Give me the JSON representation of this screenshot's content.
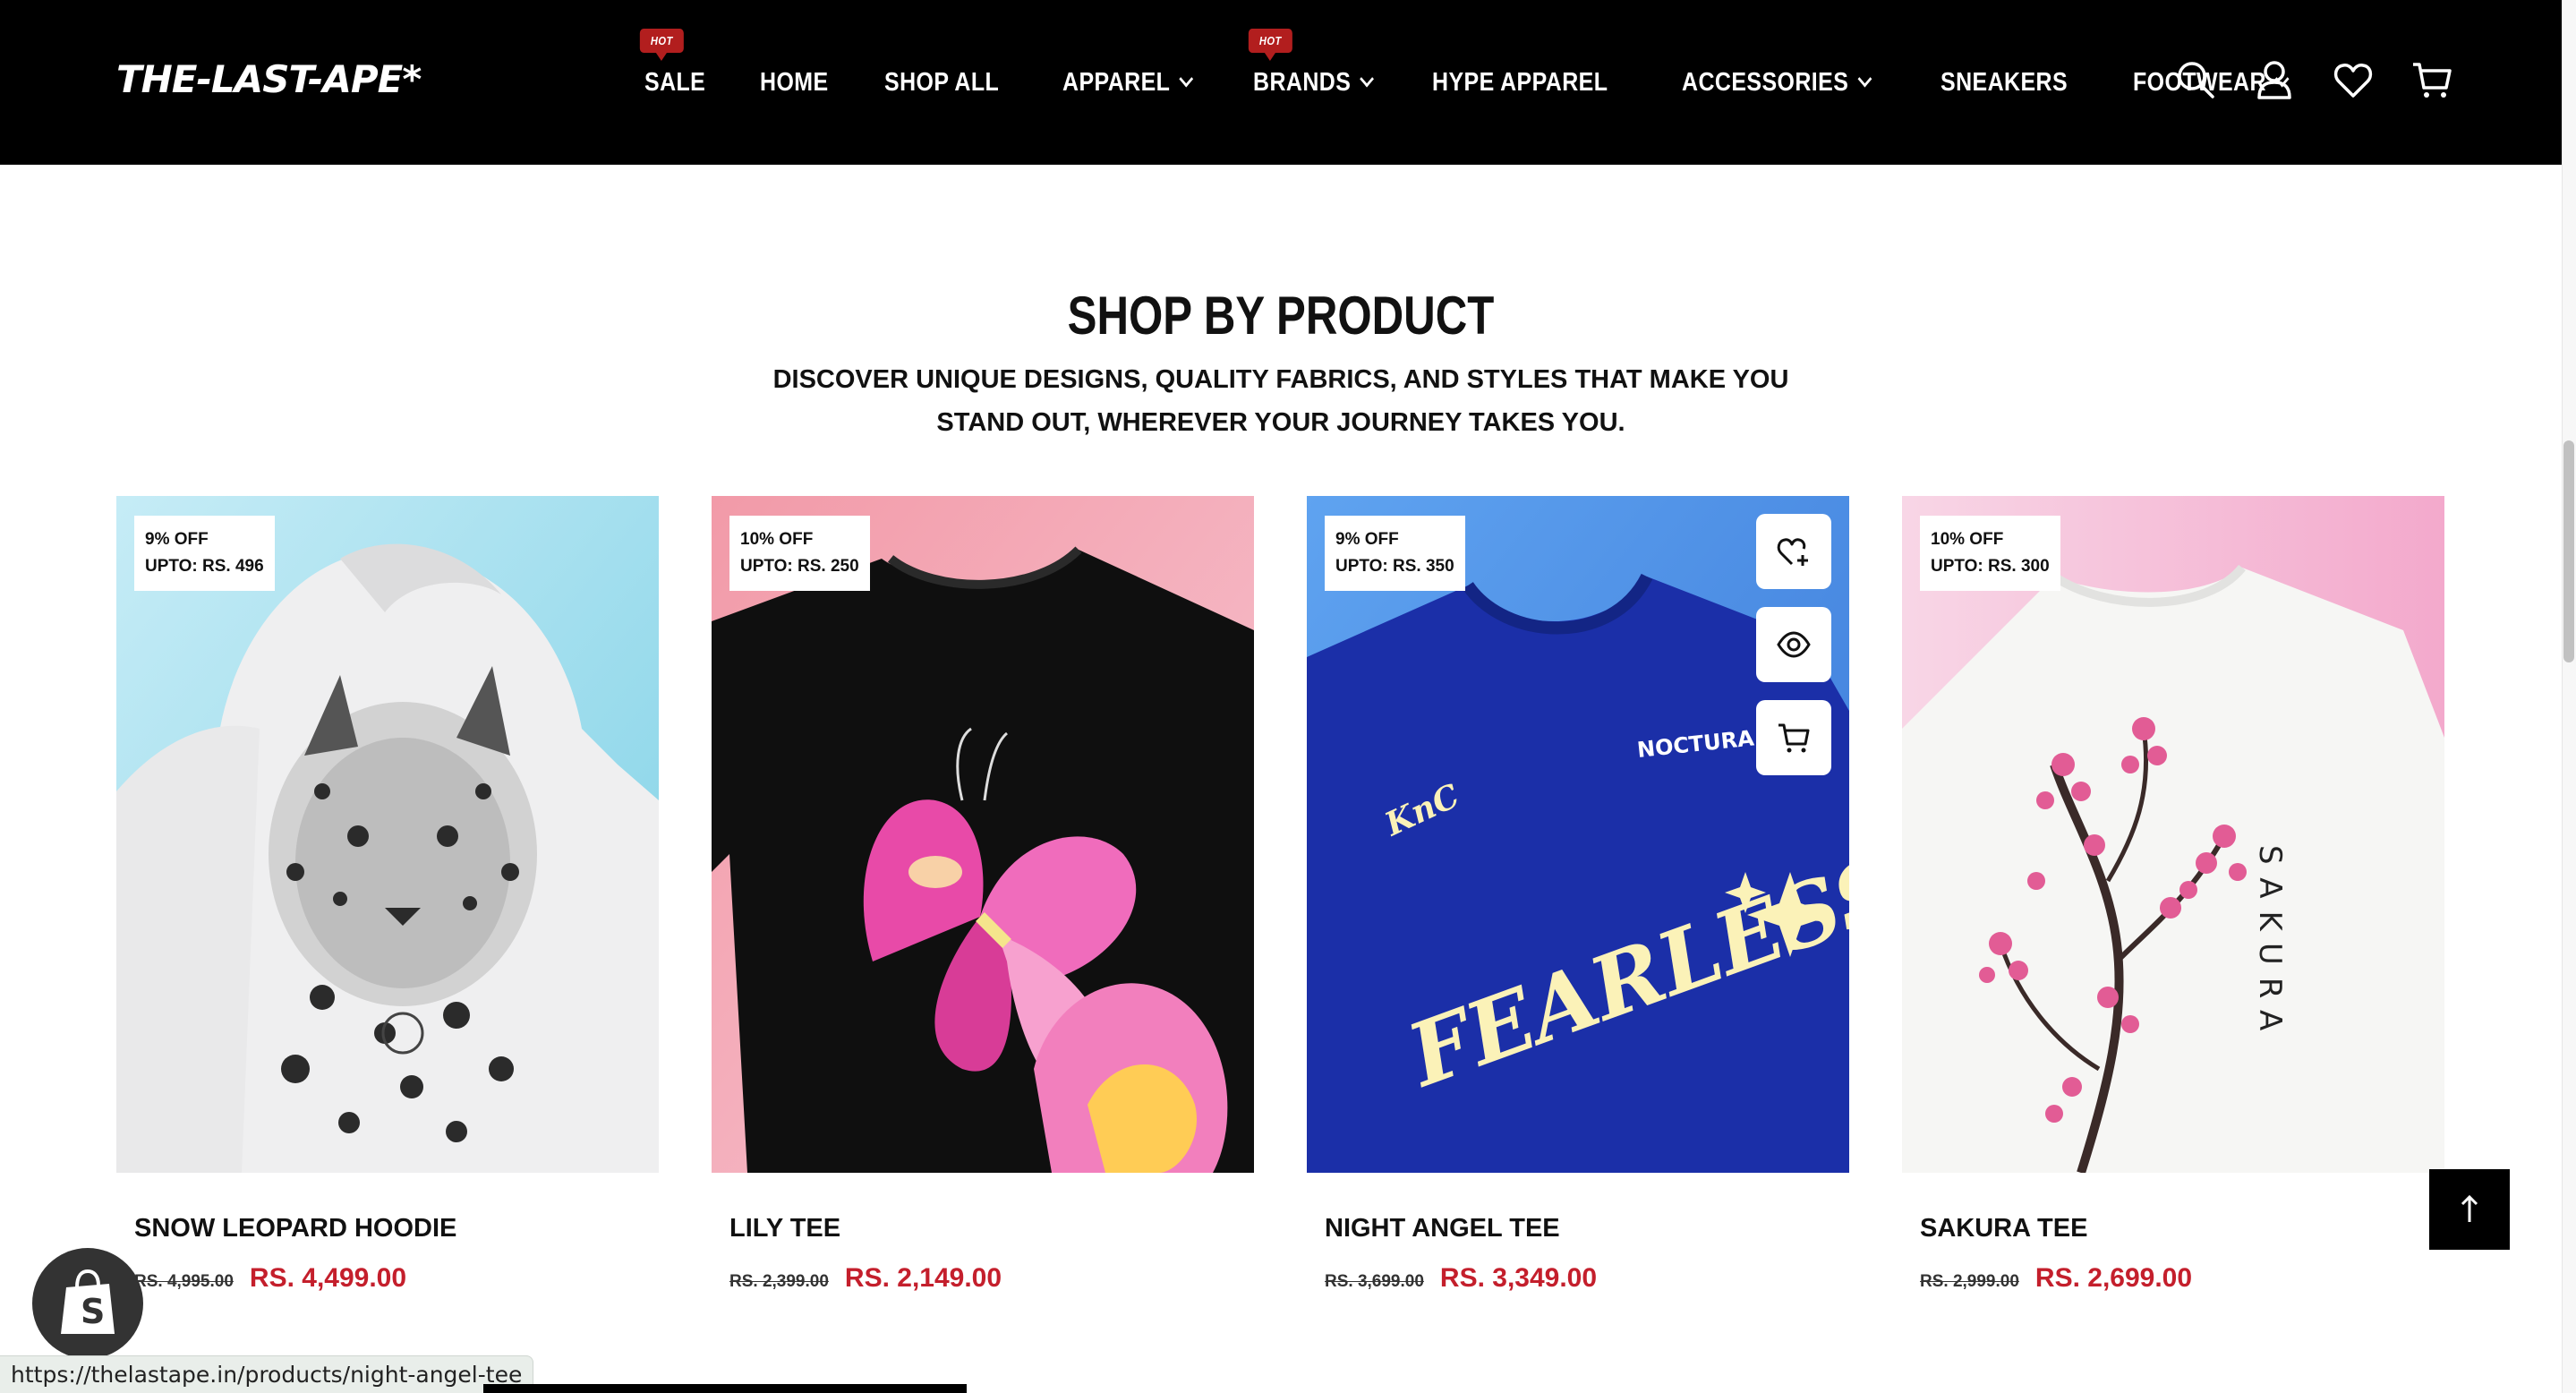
{
  "header": {
    "logo": "THE-LAST-APE*",
    "hot_badge": "HOT",
    "nav": [
      {
        "label": "SALE",
        "hot": true,
        "dropdown": false
      },
      {
        "label": "HOME",
        "hot": false,
        "dropdown": false
      },
      {
        "label": "SHOP ALL",
        "hot": false,
        "dropdown": false
      },
      {
        "label": "APPAREL",
        "hot": false,
        "dropdown": true
      },
      {
        "label": "BRANDS",
        "hot": true,
        "dropdown": true
      },
      {
        "label": "HYPE APPAREL",
        "hot": false,
        "dropdown": false
      },
      {
        "label": "ACCESSORIES",
        "hot": false,
        "dropdown": true
      },
      {
        "label": "SNEAKERS",
        "hot": false,
        "dropdown": false
      },
      {
        "label": "FOOTWEAR",
        "hot": false,
        "dropdown": true
      }
    ],
    "icons": [
      "search-icon",
      "account-icon",
      "wishlist-icon",
      "cart-icon"
    ]
  },
  "section": {
    "title": "SHOP BY PRODUCT",
    "subtitle": "DISCOVER UNIQUE DESIGNS, QUALITY FABRICS, AND STYLES THAT MAKE YOU STAND OUT, WHEREVER YOUR JOURNEY TAKES YOU."
  },
  "products": [
    {
      "name": "SNOW LEOPARD HOODIE",
      "badge_line1": "9% OFF",
      "badge_line2": "UPTO: RS. 496",
      "old_price": "RS. 4,995.00",
      "new_price": "RS. 4,499.00"
    },
    {
      "name": "LILY TEE",
      "badge_line1": "10% OFF",
      "badge_line2": "UPTO: RS. 250",
      "old_price": "RS. 2,399.00",
      "new_price": "RS. 2,149.00"
    },
    {
      "name": "NIGHT ANGEL TEE",
      "badge_line1": "9% OFF",
      "badge_line2": "UPTO: RS. 350",
      "old_price": "RS. 3,699.00",
      "new_price": "RS. 3,349.00"
    },
    {
      "name": "SAKURA TEE",
      "badge_line1": "10% OFF",
      "badge_line2": "UPTO: RS. 300",
      "old_price": "RS. 2,999.00",
      "new_price": "RS. 2,699.00"
    }
  ],
  "product_images": {
    "night_angel_front_text": "FEARLESS",
    "night_angel_brand_text": "NOCTURA",
    "night_angel_monogram": "KnC",
    "sakura_vertical_text": "SAKURA"
  },
  "hover_actions": [
    "add-to-wishlist-icon",
    "quick-view-icon",
    "add-to-cart-icon"
  ],
  "status_bar_url": "https://thelastape.in/products/night-angel-tee",
  "colors": {
    "accent": "#c41f2c",
    "hot_badge": "#b21e1e",
    "header_bg": "#000000"
  }
}
